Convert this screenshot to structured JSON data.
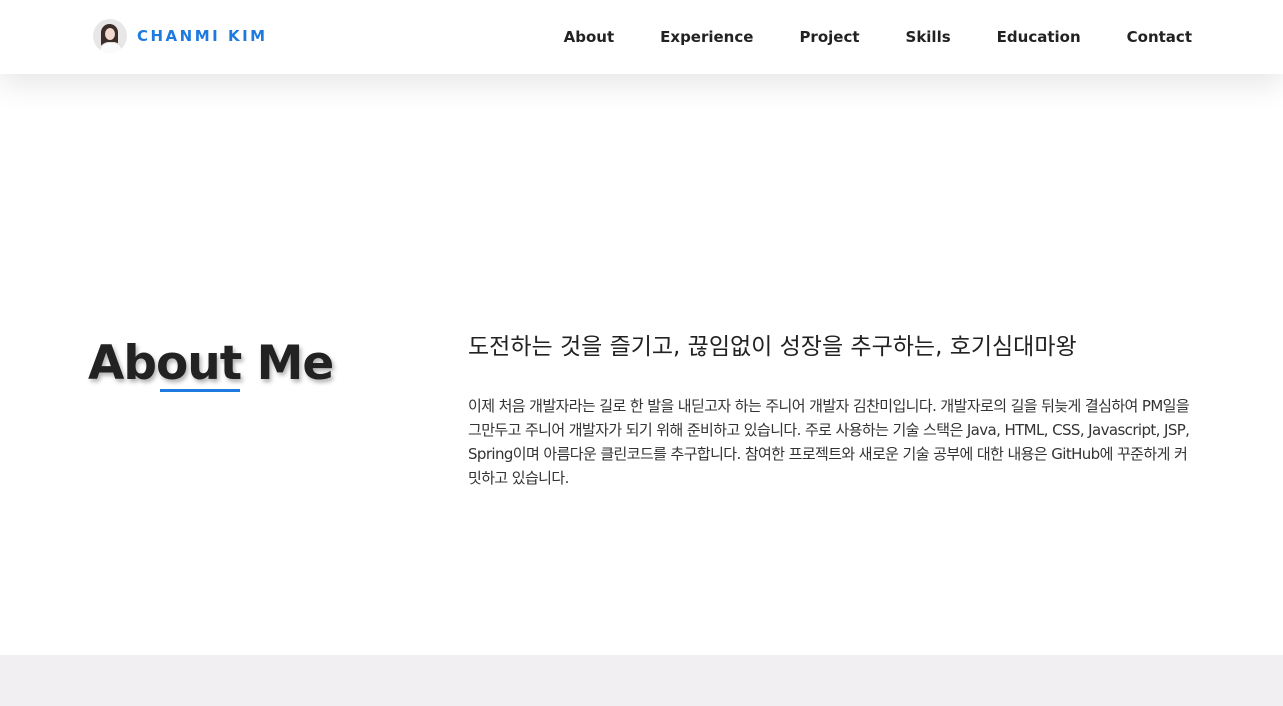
{
  "header": {
    "brand_name": "CHANMI KIM",
    "avatar_icon": "profile-photo",
    "nav": {
      "about": "About",
      "experience": "Experience",
      "project": "Project",
      "skills": "Skills",
      "education": "Education",
      "contact": "Contact"
    }
  },
  "about": {
    "title": "About Me",
    "headline": "도전하는 것을 즐기고, 끊임없이 성장을 추구하는, 호기심대마왕",
    "description": "이제 처음 개발자라는 길로 한 발을 내딛고자 하는 주니어 개발자 김찬미입니다. 개발자로의 길을 뒤늦게 결심하여 PM일을 그만두고 주니어 개발자가 되기 위해 준비하고 있습니다. 주로 사용하는 기술 스택은 Java, HTML, CSS, Javascript, JSP, Spring이며 아름다운 클린코드를 추구합니다. 참여한 프로젝트와 새로운 기술 공부에 대한 내용은 GitHub에 꾸준하게 커밋하고 있습니다."
  },
  "colors": {
    "accent": "#1f7ae0",
    "text": "#222222",
    "next_section_bg": "#f1eff2"
  }
}
